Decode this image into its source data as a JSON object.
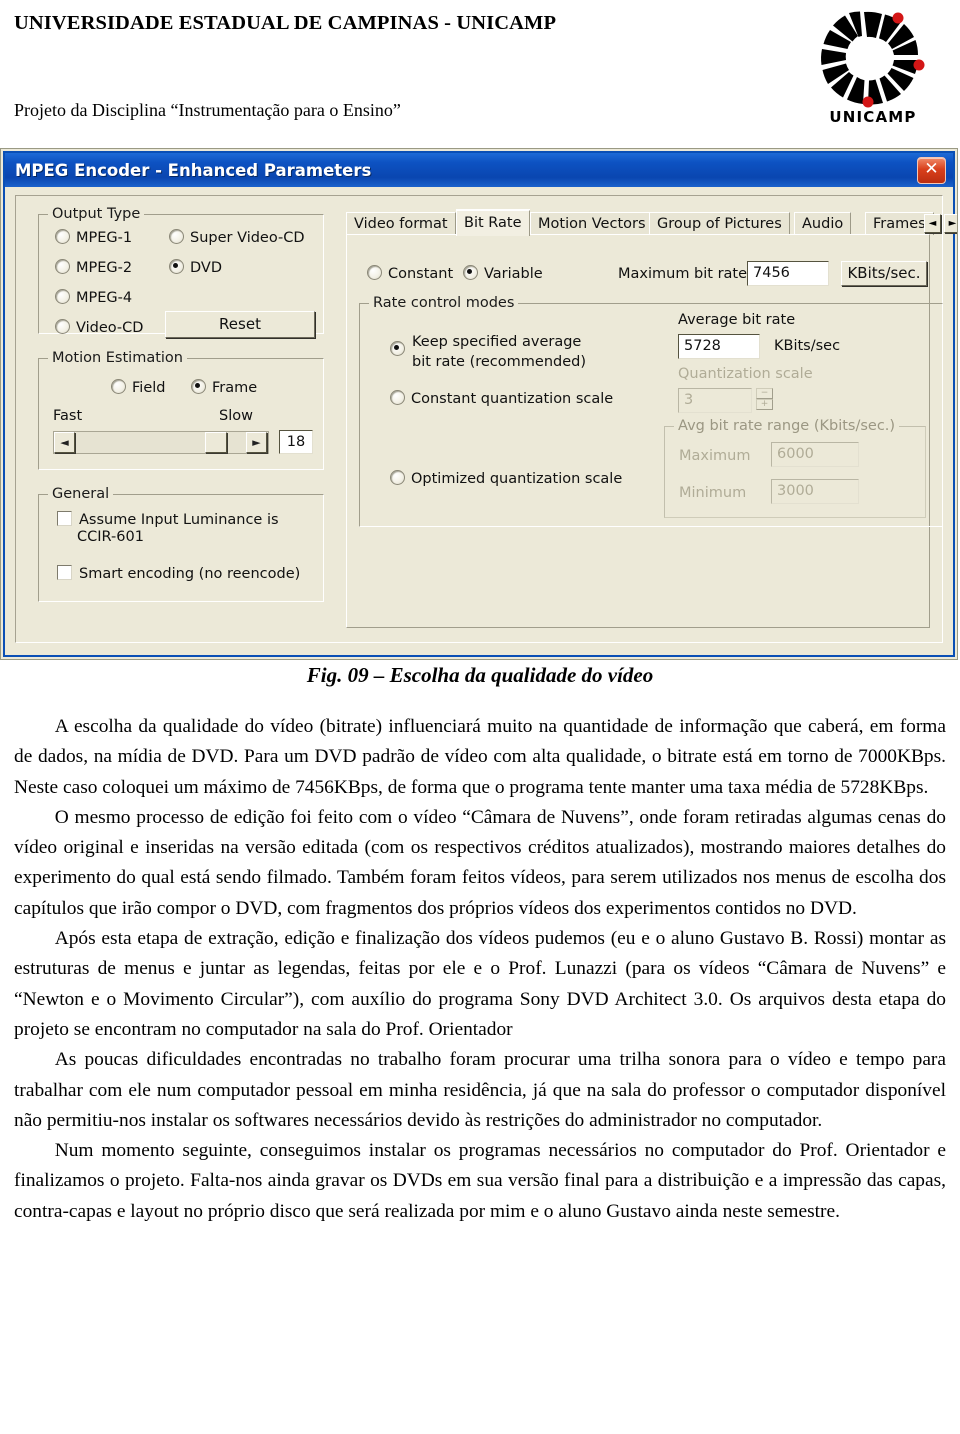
{
  "header": {
    "university": "UNIVERSIDADE ESTADUAL DE CAMPINAS - UNICAMP",
    "discipline": "Projeto da Disciplina “Instrumentação para o Ensino”",
    "logo_text": "UNICAMP"
  },
  "dialog": {
    "title": "MPEG Encoder - Enhanced Parameters",
    "close_label": "✕",
    "output_type": {
      "legend": "Output Type",
      "options": [
        {
          "label": "MPEG-1",
          "selected": false
        },
        {
          "label": "MPEG-2",
          "selected": false
        },
        {
          "label": "MPEG-4",
          "selected": false
        },
        {
          "label": "Video-CD",
          "selected": false
        },
        {
          "label": "Super Video-CD",
          "selected": false
        },
        {
          "label": "DVD",
          "selected": true
        }
      ],
      "reset_label": "Reset"
    },
    "motion_estimation": {
      "legend": "Motion Estimation",
      "field_label": "Field",
      "frame_label": "Frame",
      "field_selected": false,
      "frame_selected": true,
      "fast_label": "Fast",
      "slow_label": "Slow",
      "value": "18",
      "left_arrow": "◄",
      "right_arrow": "►"
    },
    "general": {
      "legend": "General",
      "checkbox_luminance": "Assume Input Luminance is CCIR-601",
      "checkbox_luminance_line1": "Assume Input Luminance is",
      "checkbox_luminance_line2": "CCIR-601",
      "checkbox_smart": "Smart encoding (no reencode)",
      "luminance_checked": false,
      "smart_checked": false
    },
    "tabs": [
      {
        "label": "Video format",
        "active": false
      },
      {
        "label": "Bit Rate",
        "active": true
      },
      {
        "label": "Motion Vectors",
        "active": false
      },
      {
        "label": "Group of Pictures",
        "active": false
      },
      {
        "label": "Audio",
        "active": false
      },
      {
        "label": "Frames",
        "active": false
      }
    ],
    "tab_scroll_left": "◄",
    "tab_scroll_right": "►",
    "bit_rate": {
      "constant_label": "Constant",
      "variable_label": "Variable",
      "constant_selected": false,
      "variable_selected": true,
      "max_bit_rate_label": "Maximum bit rate",
      "max_bit_rate_value": "7456",
      "max_bit_rate_unit": "KBits/sec.",
      "rate_control_legend": "Rate control modes",
      "mode_keep_line1": "Keep specified average",
      "mode_keep_line2": "bit rate (recommended)",
      "mode_keep_selected": true,
      "mode_constant_q": "Constant quantization scale",
      "mode_constant_q_selected": false,
      "mode_optimized_q": "Optimized quantization scale",
      "mode_optimized_q_selected": false,
      "avg_bit_rate_label": "Average bit rate",
      "avg_bit_rate_value": "5728",
      "avg_bit_rate_unit": "KBits/sec",
      "quant_scale_label": "Quantization scale",
      "quant_scale_value": "3",
      "spin_up": "−",
      "spin_down": "+",
      "avg_range_legend": "Avg bit rate range (Kbits/sec.)",
      "range_max_label": "Maximum",
      "range_max_value": "6000",
      "range_min_label": "Minimum",
      "range_min_value": "3000"
    }
  },
  "figure": {
    "caption": "Fig. 09 – Escolha da qualidade do vídeo"
  },
  "body": {
    "p1": "A escolha da qualidade do vídeo (bitrate) influenciará muito na quantidade de informação que caberá, em forma de dados, na mídia de DVD. Para um DVD padrão de vídeo com alta qualidade, o bitrate está em torno de 7000KBps. Neste caso coloquei um máximo de 7456KBps, de forma que o programa tente manter uma taxa média de 5728KBps.",
    "p2": "O mesmo processo de edição foi feito com o vídeo “Câmara de Nuvens”, onde foram retiradas algumas cenas do vídeo original e inseridas na versão editada (com os respectivos créditos atualizados), mostrando maiores detalhes do experimento do qual está sendo filmado. Também foram feitos vídeos, para serem utilizados nos menus de escolha dos capítulos que irão compor o DVD, com fragmentos dos próprios vídeos dos experimentos contidos no DVD.",
    "p3": "Após esta etapa de extração, edição e finalização dos vídeos pudemos (eu e o aluno Gustavo B. Rossi) montar as estruturas de menus e juntar as legendas, feitas por ele e o Prof. Lunazzi (para os vídeos “Câmara de Nuvens” e “Newton e o Movimento Circular”), com auxílio do programa Sony DVD Architect 3.0. Os arquivos desta etapa do projeto se encontram no computador na sala do Prof. Orientador",
    "p4": "As poucas dificuldades encontradas no trabalho foram procurar uma trilha sonora para o vídeo e tempo para trabalhar com ele num computador pessoal em minha residência, já que na sala do professor o computador disponível não permitiu-nos instalar os softwares necessários devido às restrições do administrador no computador.",
    "p5": "Num momento seguinte, conseguimos instalar os programas necessários no computador do Prof. Orientador e finalizamos o projeto. Falta-nos ainda gravar os DVDs em sua versão final para a distribuição e a impressão das capas, contra-capas e layout no próprio disco que será realizada por mim e o aluno Gustavo ainda neste semestre."
  }
}
